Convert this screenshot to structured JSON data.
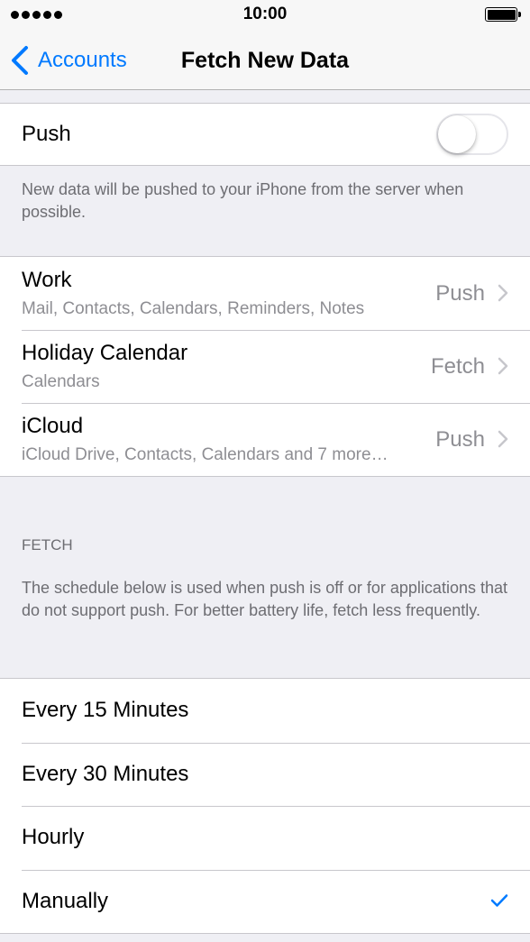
{
  "status_bar": {
    "time": "10:00",
    "signal_icon": "signal-dots-icon",
    "battery_icon": "battery-full-icon"
  },
  "nav": {
    "back_label": "Accounts",
    "title": "Fetch New Data",
    "back_icon": "chevron-left-icon"
  },
  "push": {
    "label": "Push",
    "enabled": false,
    "footer": "New data will be pushed to your iPhone from the server when possible."
  },
  "accounts": [
    {
      "name": "Work",
      "detail": "Mail, Contacts, Calendars, Reminders, Notes",
      "value": "Push"
    },
    {
      "name": "Holiday Calendar",
      "detail": "Calendars",
      "value": "Fetch"
    },
    {
      "name": "iCloud",
      "detail": "iCloud Drive, Contacts, Calendars and 7 more…",
      "value": "Push"
    }
  ],
  "fetch": {
    "header": "FETCH",
    "description": "The schedule below is used when push is off or for applications that do not support push. For better battery life, fetch less frequently.",
    "options": [
      {
        "label": "Every 15 Minutes",
        "selected": false
      },
      {
        "label": "Every 30 Minutes",
        "selected": false
      },
      {
        "label": "Hourly",
        "selected": false
      },
      {
        "label": "Manually",
        "selected": true
      }
    ]
  },
  "colors": {
    "accent": "#007aff",
    "secondary_text": "#8e8e93",
    "background": "#efeff4"
  }
}
